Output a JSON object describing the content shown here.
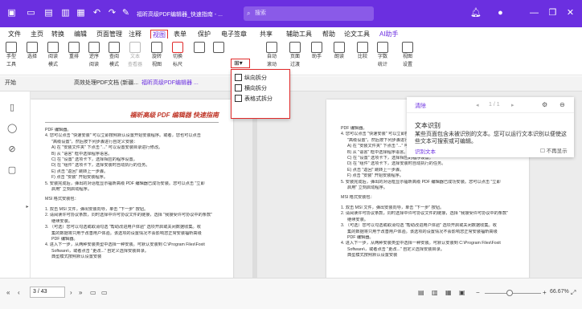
{
  "titlebar": {
    "title": "福昕高级PDF编辑器_快速指南 - ...",
    "search_placeholder": "搜索",
    "icons": [
      "app-logo",
      "new-file",
      "open-file",
      "save",
      "print",
      "undo",
      "redo",
      "brush",
      "dropdown"
    ]
  },
  "menu": [
    "文件",
    "主页",
    "转换",
    "编辑",
    "页面管理",
    "注释",
    "视图",
    "表单",
    "保护",
    "电子签章",
    "共享",
    "辅助工具",
    "帮助",
    "论文工具",
    "AI助手"
  ],
  "menu_active": "视图",
  "ribbon": [
    {
      "label1": "手型",
      "label2": "工具"
    },
    {
      "label1": "选择",
      "label2": ""
    },
    {
      "label1": "阅读",
      "label2": "模式"
    },
    {
      "label1": "重排",
      "label2": ""
    },
    {
      "label1": "逆序",
      "label2": "阅读"
    },
    {
      "label1": "查阅",
      "label2": "模式"
    },
    {
      "label1": "文本",
      "label2": "查看器"
    },
    {
      "label1": "旋转",
      "label2": "视图"
    },
    {
      "label1": "切换",
      "label2": "标尺"
    },
    {
      "label1": "",
      "label2": ""
    },
    {
      "label1": "",
      "label2": ""
    },
    {
      "label1": "自动",
      "label2": "滚动"
    },
    {
      "label1": "页面",
      "label2": "过渡"
    },
    {
      "label1": "助手",
      "label2": ""
    },
    {
      "label1": "朗读",
      "label2": ""
    },
    {
      "label1": "比较",
      "label2": ""
    },
    {
      "label1": "字数",
      "label2": "统计"
    },
    {
      "label1": "视图",
      "label2": "设置"
    }
  ],
  "split_menu": [
    "纵向拆分",
    "横向拆分",
    "表格式拆分"
  ],
  "tabs": {
    "start": "开始",
    "doc1": "高效处理PDF文档 (新疆...",
    "doc2": "福昕高级PDF编辑器 ..."
  },
  "page": {
    "header": "福昕高级 PDF 编辑器 快速指南",
    "lines": [
      "PDF 编辑器。",
      "4. 您可以点击 \"快速安装\" 可以立即按照默认设置开始安装程序。或者，您也可以点击",
      "\"高级设置\"，然后按下列步骤进行自定义安装：",
      "A) 在 \"安装文件夹\" 下点击 \"...\" 可以设置安装目录进行修改。",
      "B) 从 \"语言\" 框中选择程序语言。",
      "C) 在 \"设置\" 选项卡下，选择相应的程序设置。",
      "D) 在 \"组件\" 选项卡下，选择安装时自动执行的任务。",
      "E) 点击 \"返回\" 跳转上一步骤。",
      "F) 点击 \"安装\" 开始安装程序。",
      "5. 安装完成后，弹出的对话框显示福昕高级 PDF 编辑器已成功安装。您可以点击 \"立即",
      "启用\" 立刻启动程序。",
      "MSI 格式安装包：",
      "1. 双击 MSI 文件，弹出安装向导，单击 \"下一步\" 按钮。",
      "2. 请阅读许可协议条款，同时选择中许可协议文件的链接，选择 \"我接受许可协议中的条款\"",
      "继续安装。",
      "3. （可选）您可以勾选或取消勾选 \"帮助改进用户体验\" 选项开启或关闭数据收集。收",
      "集的数据将只用于改善用户体验。该选项的设置情况不会影响您正常安装福昕高级",
      "PDF 编辑器。",
      "4. 进入下一步，从两种安装类型中选择一种安装。可默认安装到 C:\\Program Files\\Foxit",
      "Software\\，或者点击 \"更改...\" 自定义选择安装目录。",
      "典型模式按照默认设置安装"
    ]
  },
  "panel": {
    "clear": "清除",
    "pager": "1 / 1",
    "title": "文本识别",
    "body": "某些页面包含未被识别的文本。您可以运行文本识别以便使这些文本可搜索或可编辑。",
    "link": "识别文本",
    "dont_show": "不再显示"
  },
  "status": {
    "page": "3 / 43",
    "zoom": "66.67%"
  }
}
